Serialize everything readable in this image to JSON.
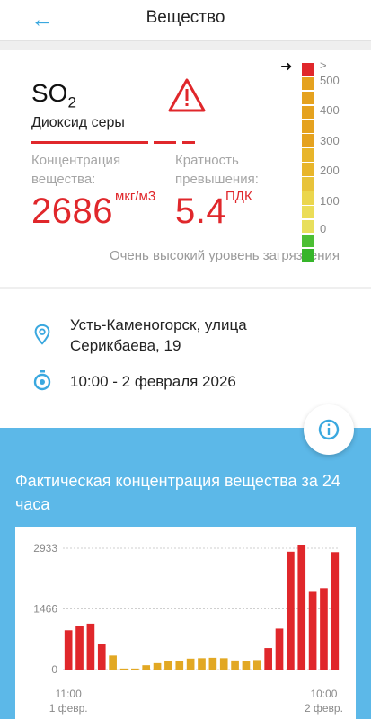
{
  "header": {
    "title": "Вещество",
    "back_icon": "arrow-left-icon"
  },
  "substance": {
    "formula_main": "SO",
    "formula_sub": "2",
    "name": "Диоксид серы",
    "concentration_label": "Концентрация вещества:",
    "concentration_value": "2686",
    "concentration_unit": "мкг/м3",
    "exceedance_label": "Кратность превышения:",
    "exceedance_value": "5.4",
    "exceedance_unit": "ПДК",
    "level_text": "Очень высокий уровень загрязнения",
    "warning_icon": "warning-triangle-icon"
  },
  "scale": {
    "labels": [
      ">",
      "500",
      "400",
      "300",
      "200",
      "100",
      "0"
    ],
    "colors": [
      "#e0272b",
      "#e5a21f",
      "#e5a21f",
      "#e5a21f",
      "#e5a21f",
      "#e5a21f",
      "#e8b52a",
      "#e8b52a",
      "#e8c33a",
      "#ebd64d",
      "#ebdd58",
      "#e8df5c",
      "#4cbf34",
      "#36b52a"
    ],
    "current_marker": "arrow-right-icon"
  },
  "location": {
    "address": "Усть-Каменогорск, улица Серикбаева, 19",
    "time": "10:00 - 2 февраля 2026",
    "location_icon": "location-pin-icon",
    "time_icon": "stopwatch-icon"
  },
  "info_button": {
    "icon": "info-icon"
  },
  "chart_title": "Фактическая концентрация вещества за 24 часа",
  "chart_data": {
    "type": "bar",
    "ylim": [
      0,
      2933
    ],
    "yticks": [
      "2933",
      "1466",
      "0"
    ],
    "xtick_labels": [
      {
        "time": "11:00",
        "date": "1 февр."
      },
      {
        "time": "10:00",
        "date": "2 февр."
      }
    ],
    "values": [
      950,
      1060,
      1110,
      630,
      340,
      25,
      25,
      105,
      155,
      210,
      215,
      265,
      275,
      285,
      275,
      220,
      200,
      230,
      520,
      990,
      2850,
      3020,
      1880,
      1970,
      2840
    ],
    "colors": [
      "#e0272b",
      "#e0272b",
      "#e0272b",
      "#e0272b",
      "#e2a823",
      "#e2a823",
      "#e2a823",
      "#e2a823",
      "#e2a823",
      "#e2a823",
      "#e2a823",
      "#e2a823",
      "#e2a823",
      "#e2a823",
      "#e2a823",
      "#e2a823",
      "#e2a823",
      "#e2a823",
      "#e0272b",
      "#e0272b",
      "#e0272b",
      "#e0272b",
      "#e0272b",
      "#e0272b",
      "#e0272b"
    ],
    "grid": true
  }
}
